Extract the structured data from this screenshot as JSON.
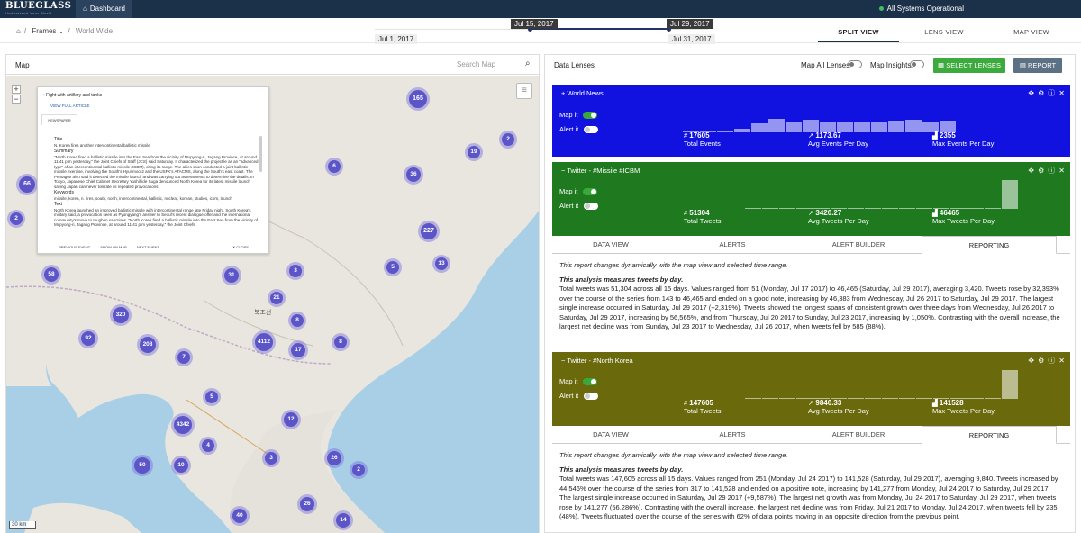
{
  "topbar": {
    "logo": "BLUEGLASS",
    "tagline": "Understand Your World",
    "dashboard": "Dashboard",
    "status": "All Systems Operational"
  },
  "breadcrumb": {
    "frames": "Frames",
    "current": "World Wide"
  },
  "timeline": {
    "start": "Jul 1, 2017",
    "sel_start": "Jul 15, 2017",
    "sel_end": "Jul 29, 2017",
    "end": "Jul 31, 2017"
  },
  "views": {
    "split": "SPLIT VIEW",
    "lens": "LENS VIEW",
    "map": "MAP VIEW"
  },
  "map": {
    "title": "Map",
    "search_placeholder": "Search Map",
    "scale": "30 km",
    "country_label": "북조선",
    "clusters": [
      {
        "label": "165"
      },
      {
        "label": "2"
      },
      {
        "label": "19"
      },
      {
        "label": "6"
      },
      {
        "label": "36"
      },
      {
        "label": "66"
      },
      {
        "label": "2"
      },
      {
        "label": "227"
      },
      {
        "label": "13"
      },
      {
        "label": "5"
      },
      {
        "label": "3"
      },
      {
        "label": "58"
      },
      {
        "label": "31"
      },
      {
        "label": "21"
      },
      {
        "label": "320"
      },
      {
        "label": "8"
      },
      {
        "label": "92"
      },
      {
        "label": "208"
      },
      {
        "label": "4112"
      },
      {
        "label": "17"
      },
      {
        "label": "8"
      },
      {
        "label": "7"
      },
      {
        "label": "5"
      },
      {
        "label": "12"
      },
      {
        "label": "4342"
      },
      {
        "label": "4"
      },
      {
        "label": "50"
      },
      {
        "label": "10"
      },
      {
        "label": "3"
      },
      {
        "label": "26"
      },
      {
        "label": "2"
      },
      {
        "label": "26"
      },
      {
        "label": "40"
      },
      {
        "label": "14"
      }
    ],
    "popup": {
      "title": "Fight with artillery and tanks",
      "view_full": "VIEW FULL ARTICLE",
      "tab": "NEWSPAPER",
      "h_title": "Title",
      "title_text": "N. Korea fires another intercontinental ballistic missile",
      "h_summary": "Summary",
      "summary_text": "\"North Korea fired a ballistic missile into the East Sea from the vicinity of Mupyong-ri, Jagang Province, at around 11:41 p.m yesterday,\" the Joint Chiefs of Staff (JCS) said Saturday. It characterized the projectile as an \"advanced type\" of an intercontinental ballistic missile (ICBM), citing its range. The allies soon conducted a joint ballistic missile exercise, involving the South's Hyunmoo-2 and the USFK's ATACMS, along the South's east coast. The Pentagon also said it detected the missile launch and was carrying out assessments to determine the details. In Tokyo, Japanese Chief Cabinet Secretary Yoshihide Suga denounced North Korea for its latest missile launch saying Japan can never tolerate its repeated provocations.",
      "h_keywords": "Keywords",
      "keywords_text": "missile, korea, n. fires, south, north, intercontinental, ballistic, nuclear, korean, studies, icbm, launch",
      "h_text": "Text",
      "text_text": "North Korea launched an improved ballistic missile with intercontinental range late Friday night, South Korea's military said, a provocation seen as Pyongyang's answer to Seoul's recent dialogue offer and the international community's move to toughen sanctions. \"North Korea fired a ballistic missile into the East Sea from the vicinity of Mupyong-ri, Jagang Province, at around 11:41 p.m yesterday,\" the Joint Chiefs",
      "prev": "← PREVIOUS EVENT",
      "show": "SHOW ON MAP",
      "next": "NEXT EVENT →",
      "close": "✕ CLOSE"
    }
  },
  "lenses_panel": {
    "title": "Data Lenses",
    "map_all": "Map All Lenses",
    "map_insights": "Map Insights",
    "select": "SELECT LENSES",
    "report": "REPORT"
  },
  "lenses": [
    {
      "name": "World News",
      "color": "#1212e0",
      "map_it": "Map it",
      "alert_it": "Alert it",
      "stats": [
        {
          "value": "17605",
          "label": "Total Events"
        },
        {
          "value": "1173.67",
          "label": "Avg Events Per Day"
        },
        {
          "value": "2355",
          "label": "Max Events Per Day"
        }
      ],
      "bars": [
        0.05,
        0.08,
        0.1,
        0.15,
        0.4,
        0.6,
        0.45,
        0.55,
        0.5,
        0.5,
        0.45,
        0.5,
        0.52,
        0.55,
        0.5,
        0.52
      ]
    },
    {
      "name": "Twitter - #Missile #ICBM",
      "color": "#1f7a1f",
      "map_it": "Map it",
      "alert_it": "Alert it",
      "stats": [
        {
          "value": "51304",
          "label": "Total Tweets"
        },
        {
          "value": "3420.27",
          "label": "Avg Tweets Per Day"
        },
        {
          "value": "46465",
          "label": "Max Tweets Per Day"
        }
      ],
      "bars": [
        0,
        0,
        0,
        0,
        0,
        0,
        0,
        0,
        0,
        0,
        0,
        0,
        0,
        0,
        0,
        1.0
      ],
      "tabs": [
        "DATA VIEW",
        "ALERTS",
        "ALERT BUILDER",
        "REPORTING"
      ],
      "report_intro": "This report changes dynamically with the map view and selected time range.",
      "report_heading": "This analysis measures tweets by day.",
      "report_text": "Total tweets was 51,304 across all 15 days. Values ranged from 51 (Monday, Jul 17 2017) to 46,465 (Saturday, Jul 29 2017), averaging 3,420. Tweets rose by 32,393% over the course of the series from 143 to 46,465 and ended on a good note, increasing by 46,383 from Wednesday, Jul 26 2017 to Saturday, Jul 29 2017. The largest single increase occurred in Saturday, Jul 29 2017 (+2,319%). Tweets showed the longest spans of consistent growth over three days from Wednesday, Jul 26 2017 to Saturday, Jul 29 2017, increasing by 56,565%, and from Thursday, Jul 20 2017 to Sunday, Jul 23 2017, increasing by 1,050%. Contrasting with the overall increase, the largest net decline was from Sunday, Jul 23 2017 to Wednesday, Jul 26 2017, when tweets fell by 585 (88%)."
    },
    {
      "name": "Twitter - #North Korea",
      "color": "#6a6a0d",
      "map_it": "Map it",
      "alert_it": "Alert it",
      "stats": [
        {
          "value": "147605",
          "label": "Total Tweets"
        },
        {
          "value": "9840.33",
          "label": "Avg Tweets Per Day"
        },
        {
          "value": "141528",
          "label": "Max Tweets Per Day"
        }
      ],
      "bars": [
        0,
        0,
        0,
        0,
        0,
        0,
        0,
        0,
        0,
        0,
        0,
        0,
        0,
        0,
        0,
        1.0
      ],
      "tabs": [
        "DATA VIEW",
        "ALERTS",
        "ALERT BUILDER",
        "REPORTING"
      ],
      "report_intro": "This report changes dynamically with the map view and selected time range.",
      "report_heading": "This analysis measures tweets by day.",
      "report_text": "Total tweets was 147,605 across all 15 days. Values ranged from 251 (Monday, Jul 24 2017) to 141,528 (Saturday, Jul 29 2017), averaging 9,840. Tweets increased by 44,546% over the course of the series from 317 to 141,528 and ended on a positive note, increasing by 141,277 from Monday, Jul 24 2017 to Saturday, Jul 29 2017. The largest single increase occurred in Saturday, Jul 29 2017 (+9,587%). The largest net growth was from Monday, Jul 24 2017 to Saturday, Jul 29 2017, when tweets rose by 141,277 (56,286%). Contrasting with the overall increase, the largest net decline was from Friday, Jul 21 2017 to Monday, Jul 24 2017, when tweets fell by 235 (48%). Tweets fluctuated over the course of the series with 62% of data points moving in an opposite direction from the previous point."
    }
  ]
}
